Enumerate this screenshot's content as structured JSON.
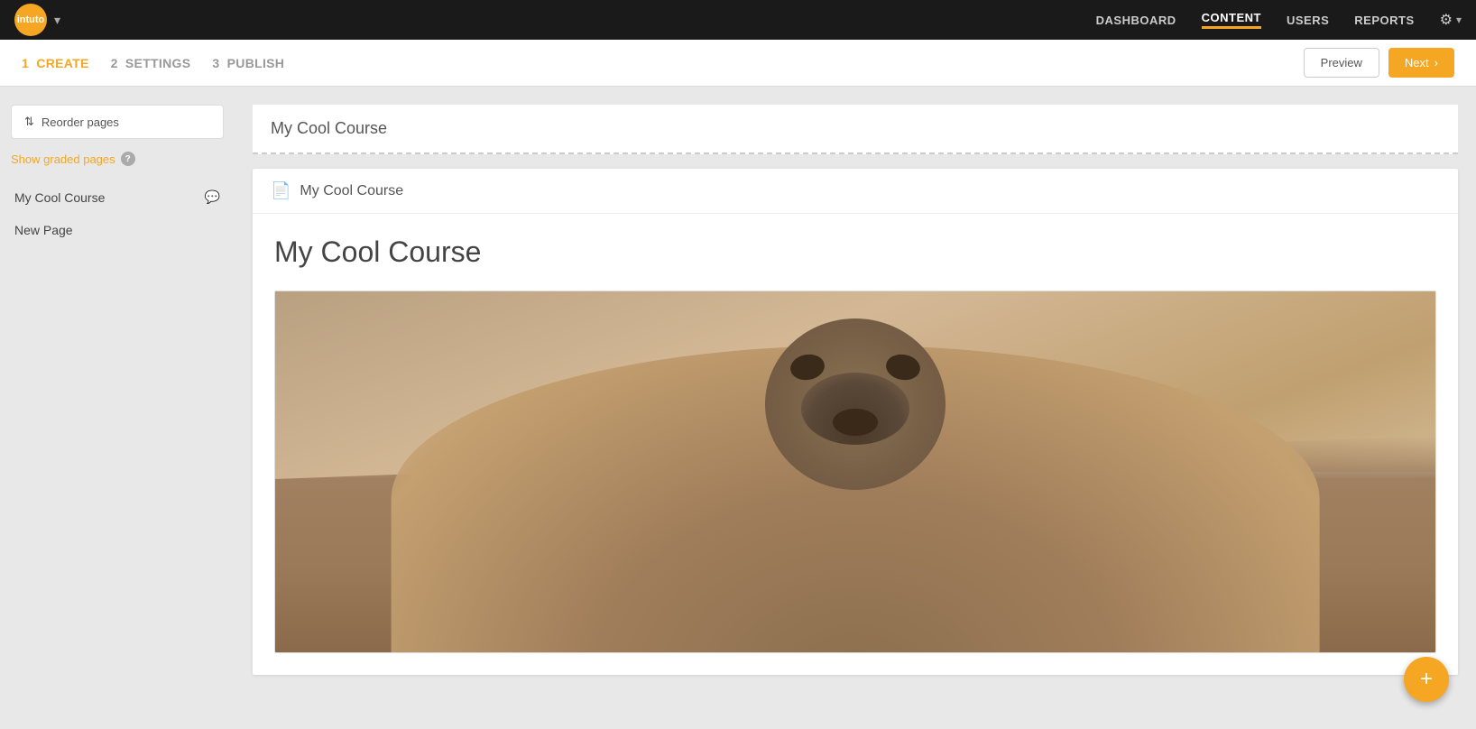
{
  "brand": {
    "logo_text": "intuto",
    "accent_color": "#f5a623"
  },
  "top_nav": {
    "links": [
      {
        "id": "dashboard",
        "label": "DASHBOARD",
        "active": false
      },
      {
        "id": "content",
        "label": "CONTENT",
        "active": true
      },
      {
        "id": "users",
        "label": "USERS",
        "active": false
      },
      {
        "id": "reports",
        "label": "REPORTS",
        "active": false
      }
    ],
    "settings_label": "⚙"
  },
  "step_bar": {
    "steps": [
      {
        "number": "1",
        "label": "CREATE",
        "active": true
      },
      {
        "number": "2",
        "label": "SETTINGS",
        "active": false
      },
      {
        "number": "3",
        "label": "PUBLISH",
        "active": false
      }
    ],
    "preview_label": "Preview",
    "next_label": "Next"
  },
  "sidebar": {
    "reorder_label": "Reorder pages",
    "show_graded_label": "Show graded pages",
    "help_icon_label": "?",
    "pages": [
      {
        "title": "My Cool Course",
        "has_comment": true
      },
      {
        "title": "New Page",
        "has_comment": false
      }
    ]
  },
  "course_editor": {
    "title_placeholder": "My Cool Course",
    "current_page_title": "My Cool Course",
    "course_heading": "My Cool Course",
    "page_icon": "📄"
  },
  "fab": {
    "icon": "+"
  }
}
